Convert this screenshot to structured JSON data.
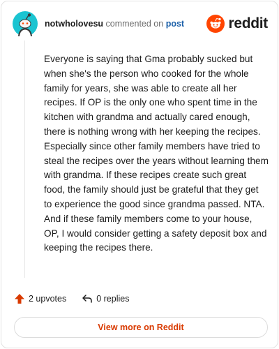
{
  "header": {
    "username": "notwholovesu",
    "action_text": "commented on",
    "post_link": "post",
    "logo_word": "reddit"
  },
  "comment": {
    "body": "Everyone is saying that Gma probably sucked but when she's the person who cooked for the whole family for years, she was able to create all her recipes. If OP is the only one who spent time in the kitchen with grandma and actually cared enough, there is nothing wrong with her keeping the recipes. Especially since other family members have tried to steal the recipes over the years without learning them with grandma. If these recipes create such great food, the family should just be grateful that they get to experience the good since grandma passed. NTA. And if these family members come to your house, OP, I would consider getting a safety deposit box and keeping the recipes there."
  },
  "actions": {
    "upvotes_label": "2 upvotes",
    "replies_label": "0 replies"
  },
  "footer": {
    "view_more_label": "View more on Reddit"
  },
  "icons": {
    "avatar": "reddit-snoo-avatar-icon",
    "logo": "reddit-logo-icon",
    "upvote": "upvote-arrow-icon",
    "reply": "reply-arrow-icon"
  },
  "colors": {
    "brand": "#ff4500",
    "upvote": "#d93a00",
    "avatar_bg": "#1bc4d1",
    "link": "#1a5fa8",
    "view_more": "#d93a00"
  }
}
